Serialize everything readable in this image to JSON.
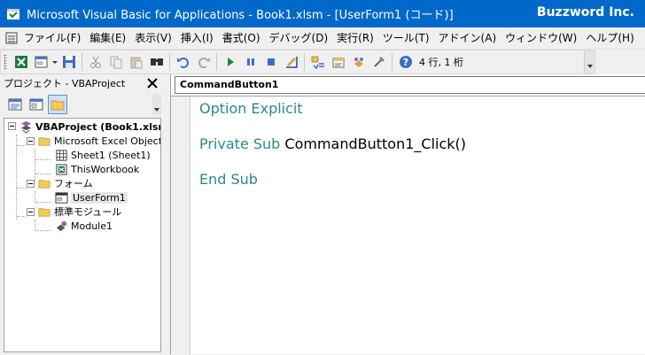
{
  "window": {
    "title": "Microsoft Visual Basic for Applications - Book1.xlsm - [UserForm1 (コード)]",
    "watermark": "Buzzword Inc."
  },
  "menu": {
    "items": [
      {
        "label": "ファイル(F)"
      },
      {
        "label": "編集(E)"
      },
      {
        "label": "表示(V)"
      },
      {
        "label": "挿入(I)"
      },
      {
        "label": "書式(O)"
      },
      {
        "label": "デバッグ(D)"
      },
      {
        "label": "実行(R)"
      },
      {
        "label": "ツール(T)"
      },
      {
        "label": "アドイン(A)"
      },
      {
        "label": "ウィンドウ(W)"
      },
      {
        "label": "ヘルプ(H)"
      }
    ]
  },
  "toolbar": {
    "cursor_position": "4 行, 1 桁",
    "icons": [
      "view-excel-icon",
      "insert-userform-icon",
      "save-icon",
      "cut-icon",
      "copy-icon",
      "paste-icon",
      "find-icon",
      "undo-icon",
      "redo-icon",
      "run-icon",
      "break-icon",
      "reset-icon",
      "design-mode-icon",
      "project-explorer-icon",
      "properties-window-icon",
      "object-browser-icon",
      "toolbox-icon",
      "help-icon"
    ]
  },
  "project": {
    "title": "プロジェクト - VBAProject",
    "tree": {
      "root": "VBAProject (Book1.xlsm)",
      "excel_objects": "Microsoft Excel Objects",
      "sheet1": "Sheet1 (Sheet1)",
      "thisworkbook": "ThisWorkbook",
      "forms": "フォーム",
      "userform1": "UserForm1",
      "modules": "標準モジュール",
      "module1": "Module1"
    }
  },
  "code": {
    "object": "CommandButton1",
    "lines": {
      "option_keyword": "Option Explicit",
      "sub_keywords": "Private Sub ",
      "sub_name": "CommandButton1_Click()",
      "end_keyword": "End Sub"
    }
  },
  "colors": {
    "titlebar": "#0068c8",
    "keyword": "#2a8a8a"
  }
}
